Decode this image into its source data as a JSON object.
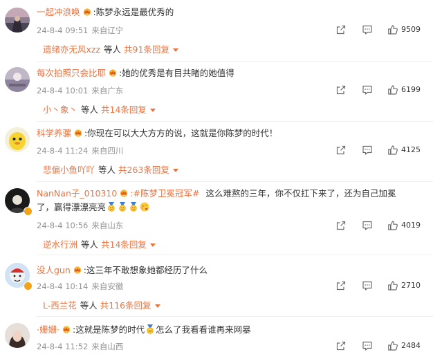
{
  "comments": [
    {
      "user": "一起冲浪唤",
      "text": ":陈梦永远是最优秀的",
      "date": "24-8-4 09:51",
      "location": "来自辽宁",
      "likes": "9509",
      "reply": {
        "user": "遗绪亦无风xzz",
        "mid": "等人",
        "total": "共91条回复"
      }
    },
    {
      "user": "每次拍照只会比耶",
      "text": ":她的优秀是有目共睹的她值得",
      "date": "24-8-4 10:01",
      "location": "来自广东",
      "likes": "6199",
      "reply": {
        "user": "小丶象丶",
        "mid": "等人",
        "total": "共14条回复"
      }
    },
    {
      "user": "科学养骡",
      "text": ":你现在可以大大方方的说，这就是你陈梦的时代！",
      "date": "24-8-4 11:24",
      "location": "来自四川",
      "likes": "4125",
      "reply": {
        "user": "悲偏小鱼吖吖",
        "mid": "等人",
        "total": "共263条回复"
      }
    },
    {
      "user": "NanNan子_010310",
      "topic": ":#陈梦卫冕冠军#",
      "text": "这么难熬的三年，你不仅扛下来了，还为自己加冕",
      "text2": "了，赢得漂漂亮亮",
      "date": "24-8-4 10:56",
      "location": "来自山东",
      "likes": "4019",
      "reply": {
        "user": "逆水行洲",
        "mid": "等人",
        "total": "共14条回复"
      }
    },
    {
      "user": "没人gun",
      "text": ":这三年不敢想象她都经历了什么",
      "date": "24-8-4 10:14",
      "location": "来自安徽",
      "likes": "2710",
      "reply": {
        "user": "L-西兰花",
        "mid": "等人",
        "total": "共116条回复"
      }
    },
    {
      "user": "·姗姗·",
      "text": ":这就是陈梦的时代",
      "text2": "怎么了我看看谁再来网暴",
      "date": "24-8-4 11:52",
      "location": "来自山西",
      "likes": "2484"
    }
  ],
  "icons": {
    "share": "share-icon",
    "comment": "comment-icon",
    "like": "thumbs-up-icon",
    "crown": "crown-badge-icon",
    "medal": "gold-medal-emoji"
  },
  "colors": {
    "username": "#eb7340",
    "meta": "#939393",
    "text": "#333333"
  }
}
